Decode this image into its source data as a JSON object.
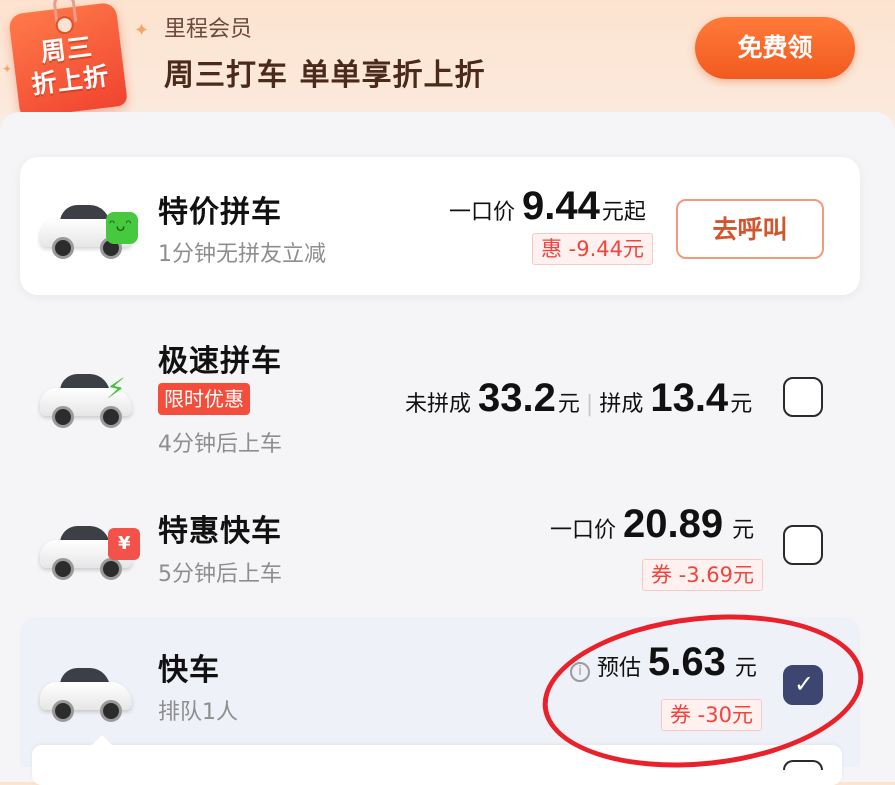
{
  "banner": {
    "tag_text": "周三\n折上折",
    "brand_label": "里程会员",
    "promo_title": "周三打车 单单享折上折",
    "claim_button": "免费领"
  },
  "options": [
    {
      "name": "特价拼车",
      "subtitle": "1分钟无拼友立减",
      "price_prefix": "一口价",
      "price": "9.44",
      "price_suffix": "元起",
      "discount": "惠 -9.44元",
      "action": "去呼叫",
      "badge_icon": "green-smile-badge-icon"
    },
    {
      "name": "极速拼车",
      "tag": "限时优惠",
      "subtitle": "4分钟后上车",
      "unmatched_label": "未拼成",
      "unmatched_price": "33.2",
      "unit": "元",
      "separator": "|",
      "matched_label": "拼成",
      "matched_price": "13.4",
      "checked": false,
      "badge_icon": "lightning-badge-icon"
    },
    {
      "name": "特惠快车",
      "subtitle": "5分钟后上车",
      "price_prefix": "一口价",
      "price": "20.89",
      "unit": "元",
      "discount": "券 -3.69元",
      "checked": false,
      "badge_icon": "yuan-ticket-badge-icon"
    },
    {
      "name": "快车",
      "subtitle": "排队1人",
      "price_prefix": "预估",
      "price": "5.63",
      "unit": "元",
      "discount": "券 -30元",
      "checked": true,
      "info_icon": "i"
    }
  ],
  "colors": {
    "accent_orange": "#f25a1e",
    "discount_red": "#f0443c",
    "checked_navy": "#3c4670",
    "annotation_red": "#e8212b"
  }
}
